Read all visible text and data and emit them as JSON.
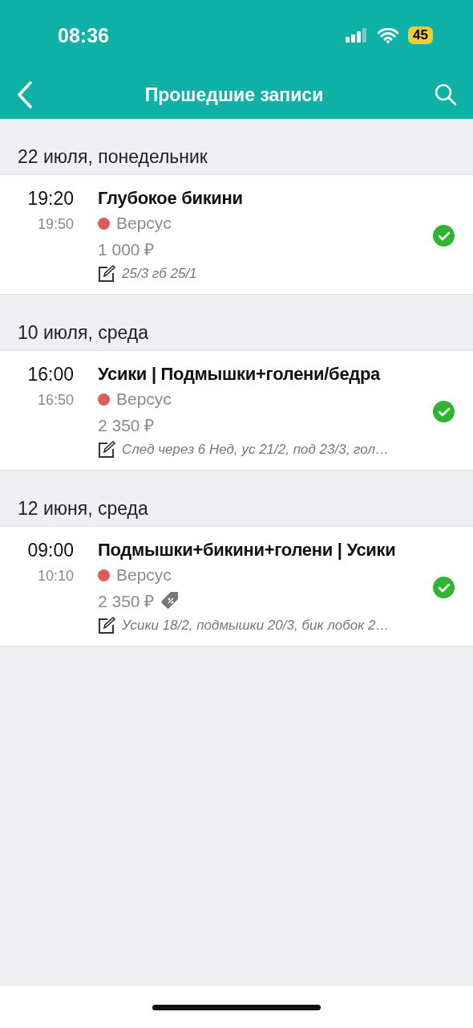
{
  "status_bar": {
    "time": "08:36",
    "battery": "45"
  },
  "header": {
    "title": "Прошедшие записи"
  },
  "sections": [
    {
      "date": "22 июля, понедельник",
      "appointments": [
        {
          "start": "19:20",
          "end": "19:50",
          "service": "Глубокое бикини",
          "staff": {
            "name": "Версус",
            "color": "#e05a5a"
          },
          "price": "1 000 ₽",
          "discount": false,
          "note": "25/3 гб 25/1",
          "completed": true
        }
      ]
    },
    {
      "date": "10 июля, среда",
      "appointments": [
        {
          "start": "16:00",
          "end": "16:50",
          "service": "Усики | Подмышки+голени/бедра",
          "staff": {
            "name": "Версус",
            "color": "#e05a5a"
          },
          "price": "2 350 ₽",
          "discount": false,
          "note": "След через 6 Нед, ус 21/2, под 23/3, гол…",
          "completed": true
        }
      ]
    },
    {
      "date": "12 июня, среда",
      "appointments": [
        {
          "start": "09:00",
          "end": "10:10",
          "service": "Подмышки+бикини+голени | Усики",
          "staff": {
            "name": "Версус",
            "color": "#e05a5a"
          },
          "price": "2 350 ₽",
          "discount": true,
          "note": "Усики 18/2, подмышки 20/3, бик лобок 2…",
          "completed": true
        }
      ]
    }
  ]
}
